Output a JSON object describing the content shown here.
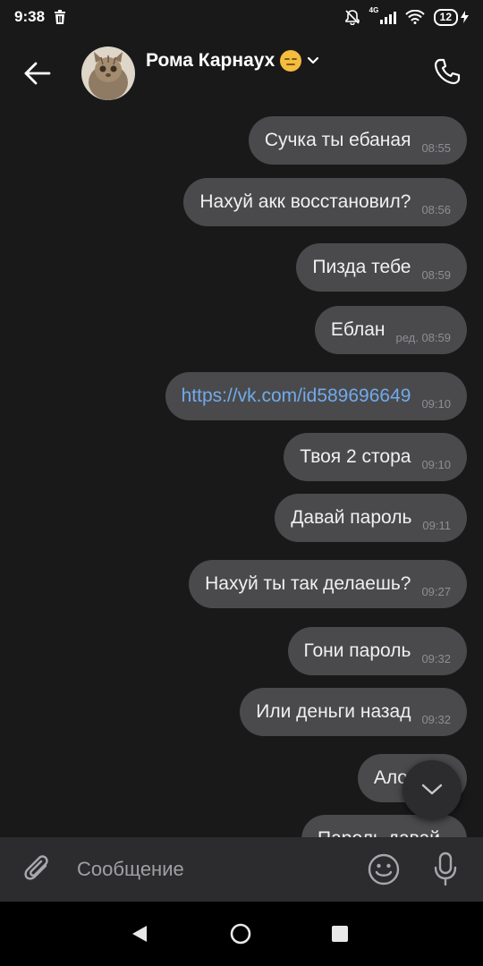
{
  "status_bar": {
    "time": "9:38",
    "network": "4G",
    "battery": "12"
  },
  "header": {
    "contact_name": "Рома Карнаух",
    "contact_emoji": "expressionless-face-emoji"
  },
  "messages": [
    {
      "text": "Сучка ты ебаная",
      "time": "08:55",
      "link": false
    },
    {
      "text": "Нахуй акк восстановил?",
      "time": "08:56",
      "link": false
    },
    {
      "text": "Пизда тебе",
      "time": "08:59",
      "link": false
    },
    {
      "text": "Еблан",
      "time": "ред. 08:59",
      "link": false
    },
    {
      "text": "https://vk.com/id589696649",
      "time": "09:10",
      "link": true
    },
    {
      "text": "Твоя 2 стора",
      "time": "09:10",
      "link": false
    },
    {
      "text": "Давай пароль",
      "time": "09:11",
      "link": false
    },
    {
      "text": "Нахуй ты так делаешь?",
      "time": "09:27",
      "link": false
    },
    {
      "text": "Гони пароль",
      "time": "09:32",
      "link": false
    },
    {
      "text": "Или деньги назад",
      "time": "09:32",
      "link": false
    },
    {
      "text": "Ало",
      "time": "",
      "link": false
    },
    {
      "text": "Пароль давай",
      "time": "",
      "link": false
    }
  ],
  "composer": {
    "placeholder": "Сообщение"
  },
  "colors": {
    "background": "#19191a",
    "bubble": "#4a4a4c",
    "link": "#71aaeb",
    "composer": "#2c2c2e"
  },
  "icons": {
    "back": "arrow-left-icon",
    "call": "phone-icon",
    "chevron": "chevron-down-icon",
    "attach": "paperclip-icon",
    "emoji": "smiley-icon",
    "mic": "microphone-icon",
    "scroll": "chevron-down-icon"
  }
}
